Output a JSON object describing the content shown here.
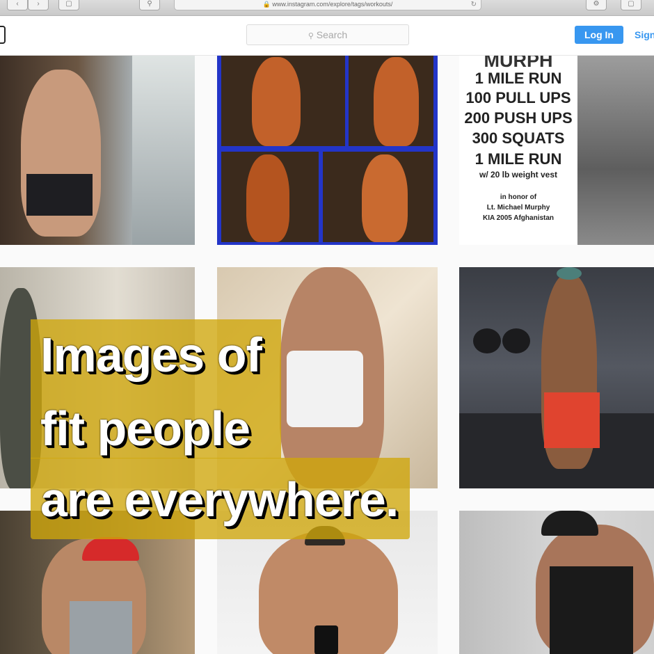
{
  "browser": {
    "url": "www.instagram.com/explore/tags/workouts/",
    "lock_icon": "lock-icon",
    "back_icon": "chevron-left-icon",
    "forward_icon": "chevron-right-icon"
  },
  "header": {
    "search_placeholder": "Search",
    "search_icon": "search-icon",
    "login_label": "Log In",
    "signup_label": "Sign Up",
    "accent_color": "#3897f0"
  },
  "grid": {
    "poster": {
      "lines": [
        "1 MILE RUN",
        "100 PULL UPS",
        "200 PUSH UPS",
        "300 SQUATS",
        "1 MILE RUN",
        "w/ 20 lb weight vest",
        "in honor of",
        "Lt. Michael Murphy",
        "KIA 2005 Afghanistan"
      ]
    }
  },
  "caption": {
    "line1": "Images of",
    "line2": "fit people",
    "line3": "are everywhere.",
    "highlight_color": "#d0a60a"
  }
}
